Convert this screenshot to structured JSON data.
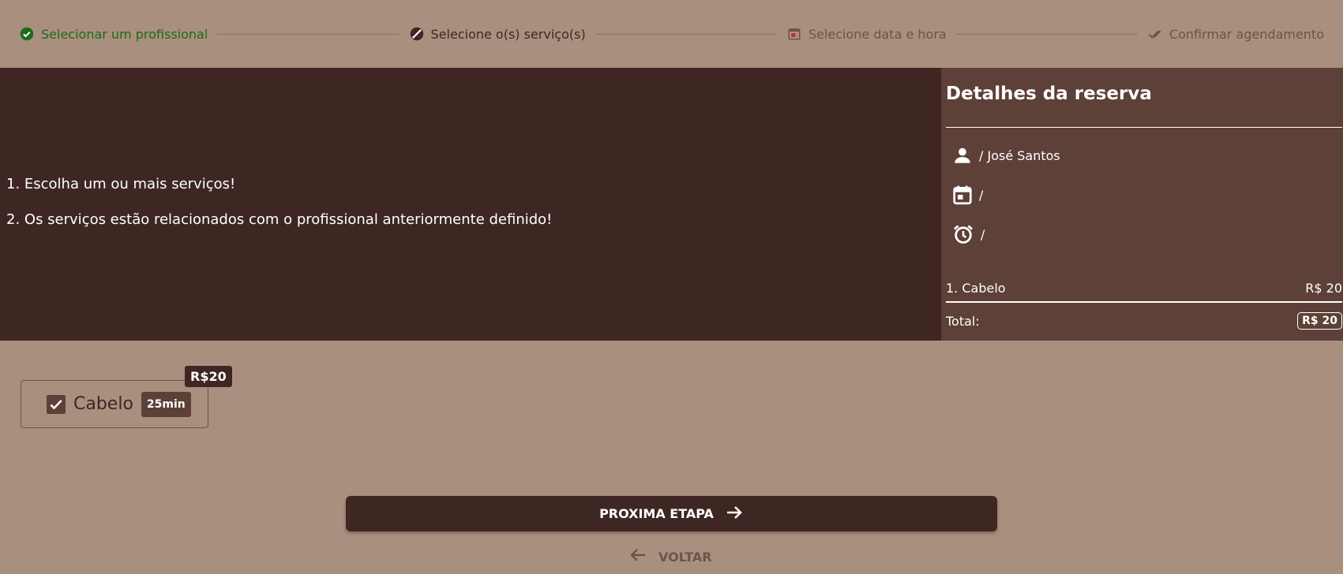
{
  "stepper": {
    "steps": [
      {
        "label": "Selecionar um profissional",
        "icon": "check-circle-icon",
        "state": "done"
      },
      {
        "label": "Selecione o(s) serviço(s)",
        "icon": "half-circle-icon",
        "state": "active"
      },
      {
        "label": "Selecione data e hora",
        "icon": "calendar-icon",
        "state": "todo"
      },
      {
        "label": "Confirmar agendamento",
        "icon": "double-check-icon",
        "state": "todo"
      }
    ]
  },
  "instructions": [
    "1. Escolha um ou mais serviços!",
    "2. Os serviços estão relacionados com o profissional anteriormente definido!"
  ],
  "details": {
    "title": "Detalhes da reserva",
    "professional": "/ José Santos",
    "date": "/",
    "time": "/",
    "service_line": {
      "name": "1. Cabelo",
      "price": "R$ 20"
    },
    "total_label": "Total:",
    "total_value": "R$ 20"
  },
  "service_card": {
    "name": "Cabelo",
    "duration": "25min",
    "price": "R$20",
    "checked": true
  },
  "actions": {
    "next_label": "PROXIMA ETAPA",
    "back_label": "VOLTAR"
  },
  "colors": {
    "background": "#a98f7e",
    "dark_brown": "#3e2723",
    "medium_brown": "#5d4037",
    "done_green": "#1b6b1b"
  }
}
